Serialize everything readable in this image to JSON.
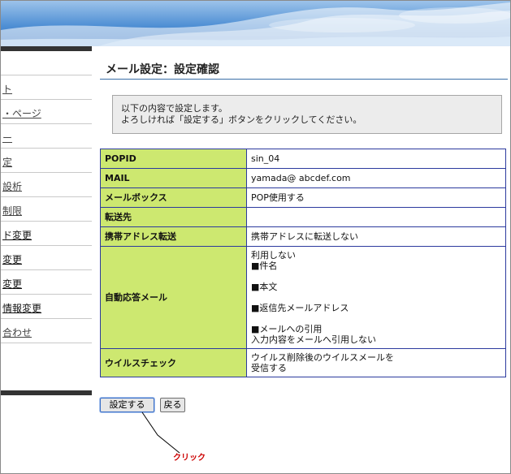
{
  "sidebar": {
    "items": [
      "",
      "ト",
      "・ページ",
      "ー",
      "定",
      "設析",
      "制限",
      "ド変更",
      "変更",
      "変更",
      "情報変更",
      "合わせ"
    ]
  },
  "page": {
    "title": "メール設定：設定確認",
    "notice_line1": "以下の内容で設定します。",
    "notice_line2": "よろしければ「設定する」ボタンをクリックしてください。"
  },
  "settings": {
    "rows": [
      {
        "key": "POPID",
        "value": [
          "sin_04"
        ]
      },
      {
        "key": "MAIL",
        "value": [
          "yamada@ abcdef.com"
        ]
      },
      {
        "key": "メールボックス",
        "value": [
          "POP使用する"
        ]
      },
      {
        "key": "転送先",
        "value": [
          ""
        ]
      },
      {
        "key": "携帯アドレス転送",
        "value": [
          "携帯アドレスに転送しない"
        ]
      },
      {
        "key": "自動応答メール",
        "value": [
          "利用しない",
          "■件名",
          "",
          "■本文",
          "",
          "■返信先メールアドレス",
          "",
          "■メールへの引用",
          "入力内容をメールへ引用しない"
        ]
      },
      {
        "key": "ウイルスチェック",
        "value": [
          "ウイルス削除後のウイルスメールを",
          "受信する"
        ]
      }
    ]
  },
  "buttons": {
    "submit_label": "設定する",
    "back_label": "戻る"
  },
  "annotation": {
    "click_label": "クリック",
    "color": "#cc0000"
  },
  "colors": {
    "key_cell": "#cde870",
    "table_border": "#2c3a9e",
    "title_rule": "#3b6fa8"
  }
}
